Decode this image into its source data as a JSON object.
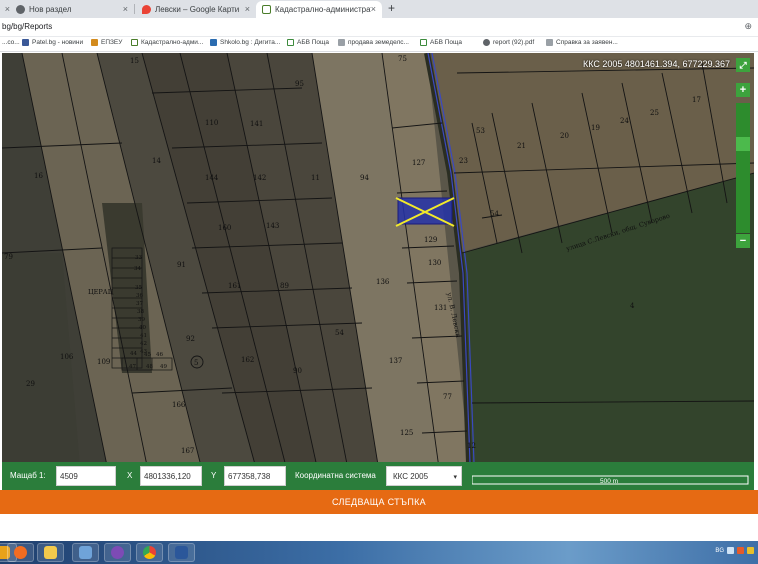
{
  "browser": {
    "tabs": [
      {
        "label": "Нов раздел",
        "active": false
      },
      {
        "label": "Левски – Google Карти",
        "active": false
      },
      {
        "label": "Кадастрално-административна",
        "active": true
      }
    ],
    "new_tab_label": "+",
    "url": "bg/bg/Reports",
    "bookmarks": [
      {
        "label": "...co..."
      },
      {
        "label": "Patel.bg - новини"
      },
      {
        "label": "ЕПЗЕУ"
      },
      {
        "label": "Кадастрално-адми..."
      },
      {
        "label": "Shkolo.bg : Дигита..."
      },
      {
        "label": "АБВ Поща"
      },
      {
        "label": "продава земеделс..."
      },
      {
        "label": "АБВ Поща"
      },
      {
        "label": "report (92).pdf"
      },
      {
        "label": "Справка за заявен..."
      }
    ]
  },
  "map": {
    "coordinate_readout": "ККС 2005 4801461.394, 677229.367",
    "zoom_in_label": "+",
    "zoom_out_label": "−",
    "fullscreen_label": "⤢",
    "street_label_main": "ул. В. Левски",
    "street_label_diag": "улица С.Левски, общ. Суворово",
    "village_label": "ЦЕРАЦ",
    "parcel_labels": [
      {
        "t": "15"
      },
      {
        "t": "95"
      },
      {
        "t": "75"
      },
      {
        "t": "110"
      },
      {
        "t": "141"
      },
      {
        "t": "14"
      },
      {
        "t": "144"
      },
      {
        "t": "142"
      },
      {
        "t": "11"
      },
      {
        "t": "94"
      },
      {
        "t": "127"
      },
      {
        "t": "16"
      },
      {
        "t": "160"
      },
      {
        "t": "143"
      },
      {
        "t": "129"
      },
      {
        "t": "91"
      },
      {
        "t": "130"
      },
      {
        "t": "161"
      },
      {
        "t": "89"
      },
      {
        "t": "136"
      },
      {
        "t": "131"
      },
      {
        "t": "54"
      },
      {
        "t": "92"
      },
      {
        "t": "162"
      },
      {
        "t": "90"
      },
      {
        "t": "137"
      },
      {
        "t": "106"
      },
      {
        "t": "109"
      },
      {
        "t": "29"
      },
      {
        "t": "166"
      },
      {
        "t": "77"
      },
      {
        "t": "125"
      },
      {
        "t": "167"
      },
      {
        "t": "5"
      },
      {
        "t": "53"
      },
      {
        "t": "23"
      },
      {
        "t": "21"
      },
      {
        "t": "20"
      },
      {
        "t": "19"
      },
      {
        "t": "24"
      },
      {
        "t": "25"
      },
      {
        "t": "17"
      },
      {
        "t": "54"
      },
      {
        "t": "4"
      },
      {
        "t": "79"
      },
      {
        "t": "33"
      },
      {
        "t": "34"
      },
      {
        "t": "35"
      },
      {
        "t": "36"
      },
      {
        "t": "37"
      },
      {
        "t": "38"
      },
      {
        "t": "39"
      },
      {
        "t": "40"
      },
      {
        "t": "41"
      },
      {
        "t": "42"
      },
      {
        "t": "43"
      },
      {
        "t": "44"
      },
      {
        "t": "45"
      },
      {
        "t": "46"
      },
      {
        "t": "47"
      },
      {
        "t": "48"
      },
      {
        "t": "49"
      },
      {
        "t": "12"
      }
    ],
    "scale_label": "500 m"
  },
  "panel": {
    "scale_label": "Мащаб 1:",
    "scale_value": "4509",
    "x_label": "X",
    "x_value": "4801336,120",
    "y_label": "Y",
    "y_value": "677358,738",
    "crs_label": "Координатна система",
    "crs_value": "ККС 2005"
  },
  "next_step_label": "СЛЕДВАЩА СТЪПКА",
  "taskbar": {
    "tray_text": "BG"
  },
  "colors": {
    "panel_green": "#2b7d3b",
    "next_orange": "#e66a13",
    "selection_blue": "#2432a8",
    "selection_cross": "#f2ea2a"
  }
}
